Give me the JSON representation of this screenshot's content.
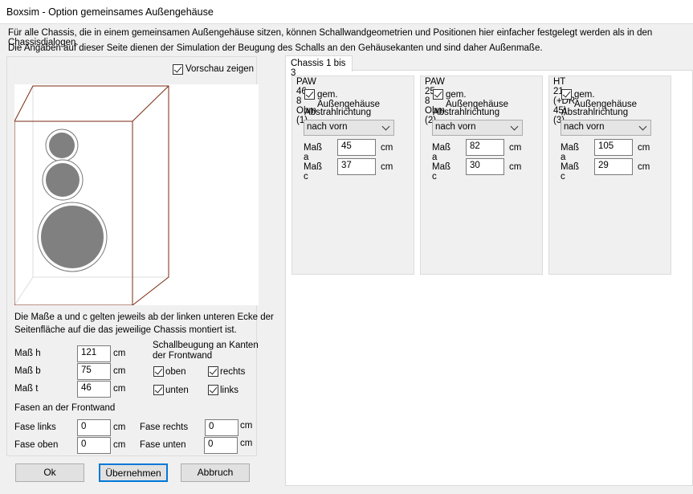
{
  "window": {
    "title": "Boxsim - Option gemeinsames Außengehäuse"
  },
  "intro": {
    "line1": "Für alle Chassis, die in einem gemeinsamen Außengehäuse sitzen, können Schallwandgeometrien und Positionen hier einfacher festgelegt werden als in den Chassisdialogen.",
    "line2": "Die Angaben auf dieser Seite dienen der Simulation der  Beugung des Schalls an den Gehäusekanten und sind daher Außenmaße."
  },
  "left": {
    "preview_label": "Vorschau zeigen",
    "preview_checked": true,
    "note1": "Die Maße a und c gelten jeweils ab der linken unteren Ecke der",
    "note2": "Seitenfläche auf die das jeweilige Chassis montiert ist.",
    "dims": [
      {
        "label": "Maß h",
        "value": "121",
        "unit": "cm"
      },
      {
        "label": "Maß b",
        "value": "75",
        "unit": "cm"
      },
      {
        "label": "Maß t",
        "value": "46",
        "unit": "cm"
      }
    ],
    "diffraction_title1": "Schallbeugung an Kanten",
    "diffraction_title2": "der Frontwand",
    "edges": {
      "oben": "oben",
      "rechts": "rechts",
      "unten": "unten",
      "links": "links"
    },
    "bevel_title": "Fasen an der Frontwand",
    "bevels": {
      "links": {
        "label": "Fase links",
        "value": "0",
        "unit": "cm"
      },
      "rechts": {
        "label": "Fase rechts",
        "value": "0",
        "unit": "cm"
      },
      "oben": {
        "label": "Fase oben",
        "value": "0",
        "unit": "cm"
      },
      "unten": {
        "label": "Fase unten",
        "value": "0",
        "unit": "cm"
      }
    }
  },
  "buttons": {
    "ok": "Ok",
    "apply": "Übernehmen",
    "cancel": "Abbruch"
  },
  "tab": {
    "label": "Chassis 1 bis 3"
  },
  "chassis": [
    {
      "title": "PAW 46 - 8 Ohm (1)",
      "shared": "gem. Außengehäuse",
      "dir_label": "Abstrahlrichtung",
      "dir": "nach vorn",
      "a_label": "Maß a",
      "a": "45",
      "c_label": "Maß c",
      "c": "37",
      "unit": "cm"
    },
    {
      "title": "PAW 25 - 8 Ohm (2)",
      "shared": "gem. Außengehäuse",
      "dir_label": "Abstrahlrichtung",
      "dir": "nach vorn",
      "a_label": "Maß a",
      "a": "82",
      "c_label": "Maß c",
      "c": "30",
      "unit": "cm"
    },
    {
      "title": "HT 21 (+DR 45) (3)",
      "shared": "gem. Außengehäuse",
      "dir_label": "Abstrahlrichtung",
      "dir": "nach vorn",
      "a_label": "Maß a",
      "a": "105",
      "c_label": "Maß c",
      "c": "29",
      "unit": "cm"
    }
  ]
}
